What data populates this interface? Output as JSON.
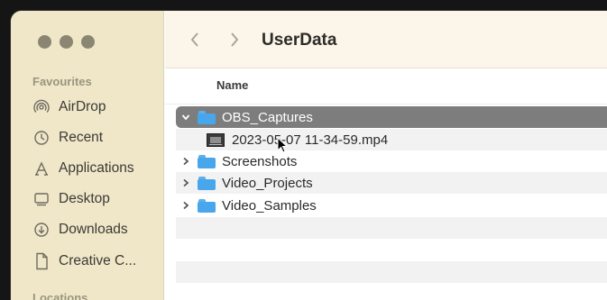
{
  "sidebar": {
    "section_favourites": "Favourites",
    "items": [
      {
        "label": "AirDrop",
        "icon": "airdrop-icon"
      },
      {
        "label": "Recent",
        "icon": "clock-icon"
      },
      {
        "label": "Applications",
        "icon": "applications-icon"
      },
      {
        "label": "Desktop",
        "icon": "desktop-icon"
      },
      {
        "label": "Downloads",
        "icon": "downloads-icon"
      },
      {
        "label": "Creative C...",
        "icon": "document-icon"
      }
    ],
    "section_locations": "Locations"
  },
  "toolbar": {
    "title": "UserData"
  },
  "columns": {
    "name": "Name"
  },
  "files": [
    {
      "name": "OBS_Captures",
      "type": "folder",
      "expanded": true,
      "selected": true
    },
    {
      "name": "2023-05-07 11-34-59.mp4",
      "type": "video",
      "child": true
    },
    {
      "name": "Screenshots",
      "type": "folder",
      "expanded": false
    },
    {
      "name": "Video_Projects",
      "type": "folder",
      "expanded": false
    },
    {
      "name": "Video_Samples",
      "type": "folder",
      "expanded": false
    }
  ],
  "colors": {
    "sidebar_bg": "#f0e7c9",
    "selection": "#7d7d7d",
    "folder": "#47a6ec"
  }
}
